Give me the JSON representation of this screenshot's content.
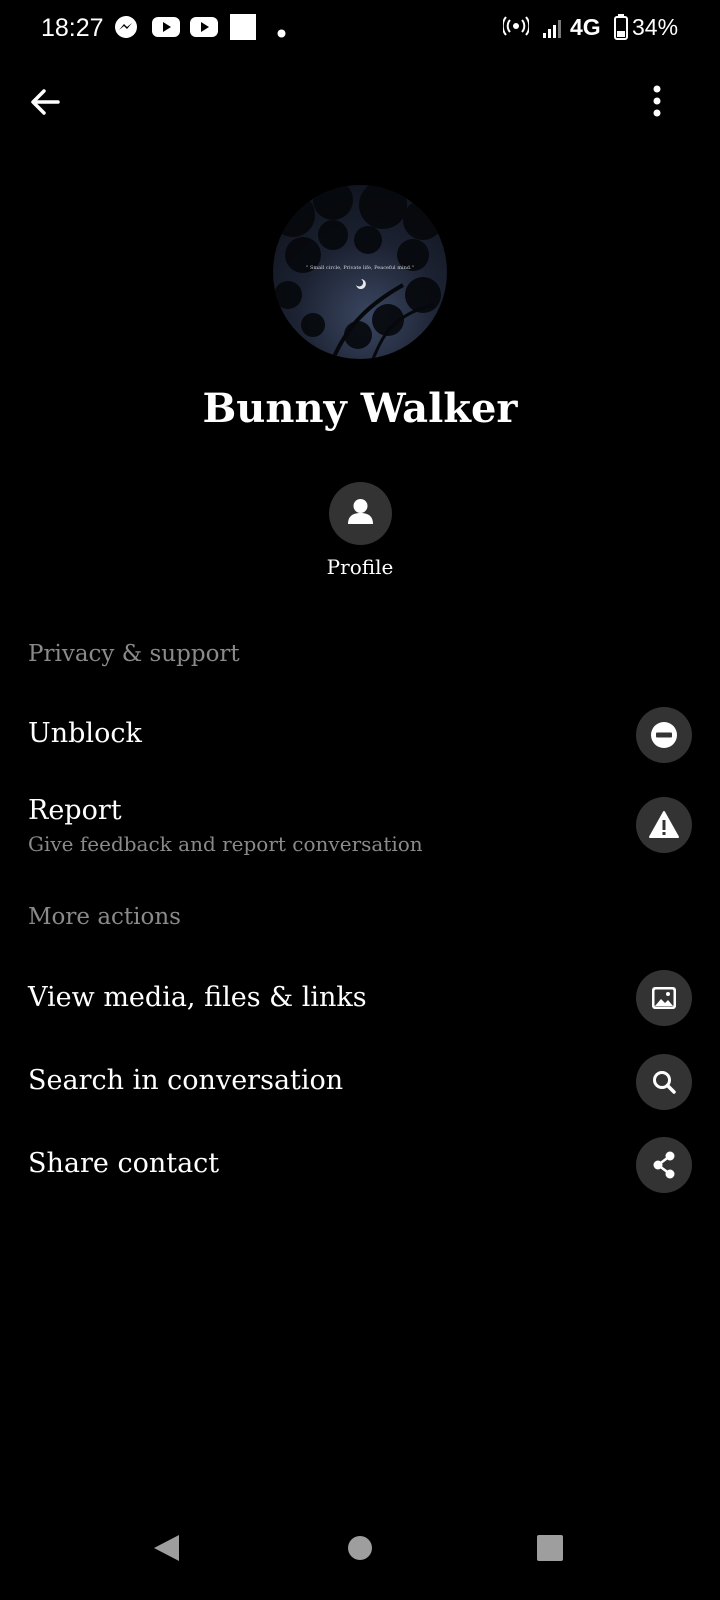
{
  "status_bar": {
    "time": "18:27",
    "network": "4G",
    "battery": "34%",
    "icons": [
      "messenger-icon",
      "youtube-icon",
      "youtube-icon",
      "square-icon",
      "dot-icon",
      "hotspot-icon",
      "signal-icon",
      "battery-icon"
    ]
  },
  "top_bar": {
    "back_icon": "arrow-left-icon",
    "menu_icon": "more-vertical-icon"
  },
  "avatar": {
    "caption": "\" Small circle, Private life, Peaceful mind.\""
  },
  "contact": {
    "name": "Bunny Walker"
  },
  "profile_action": {
    "label": "Profile",
    "icon": "person-icon"
  },
  "sections": {
    "privacy_title": "Privacy & support",
    "more_title": "More actions"
  },
  "items": {
    "unblock": {
      "title": "Unblock",
      "icon": "minus-circle-icon"
    },
    "report": {
      "title": "Report",
      "subtitle": "Give feedback and report conversation",
      "icon": "warning-icon"
    },
    "media": {
      "title": "View media, files & links",
      "icon": "image-icon"
    },
    "search": {
      "title": "Search in conversation",
      "icon": "search-icon"
    },
    "share": {
      "title": "Share contact",
      "icon": "share-icon"
    }
  },
  "colors": {
    "background": "#000000",
    "icon_circle": "#333333",
    "secondary_text": "#8a8a8a",
    "primary_text": "#ffffff"
  }
}
